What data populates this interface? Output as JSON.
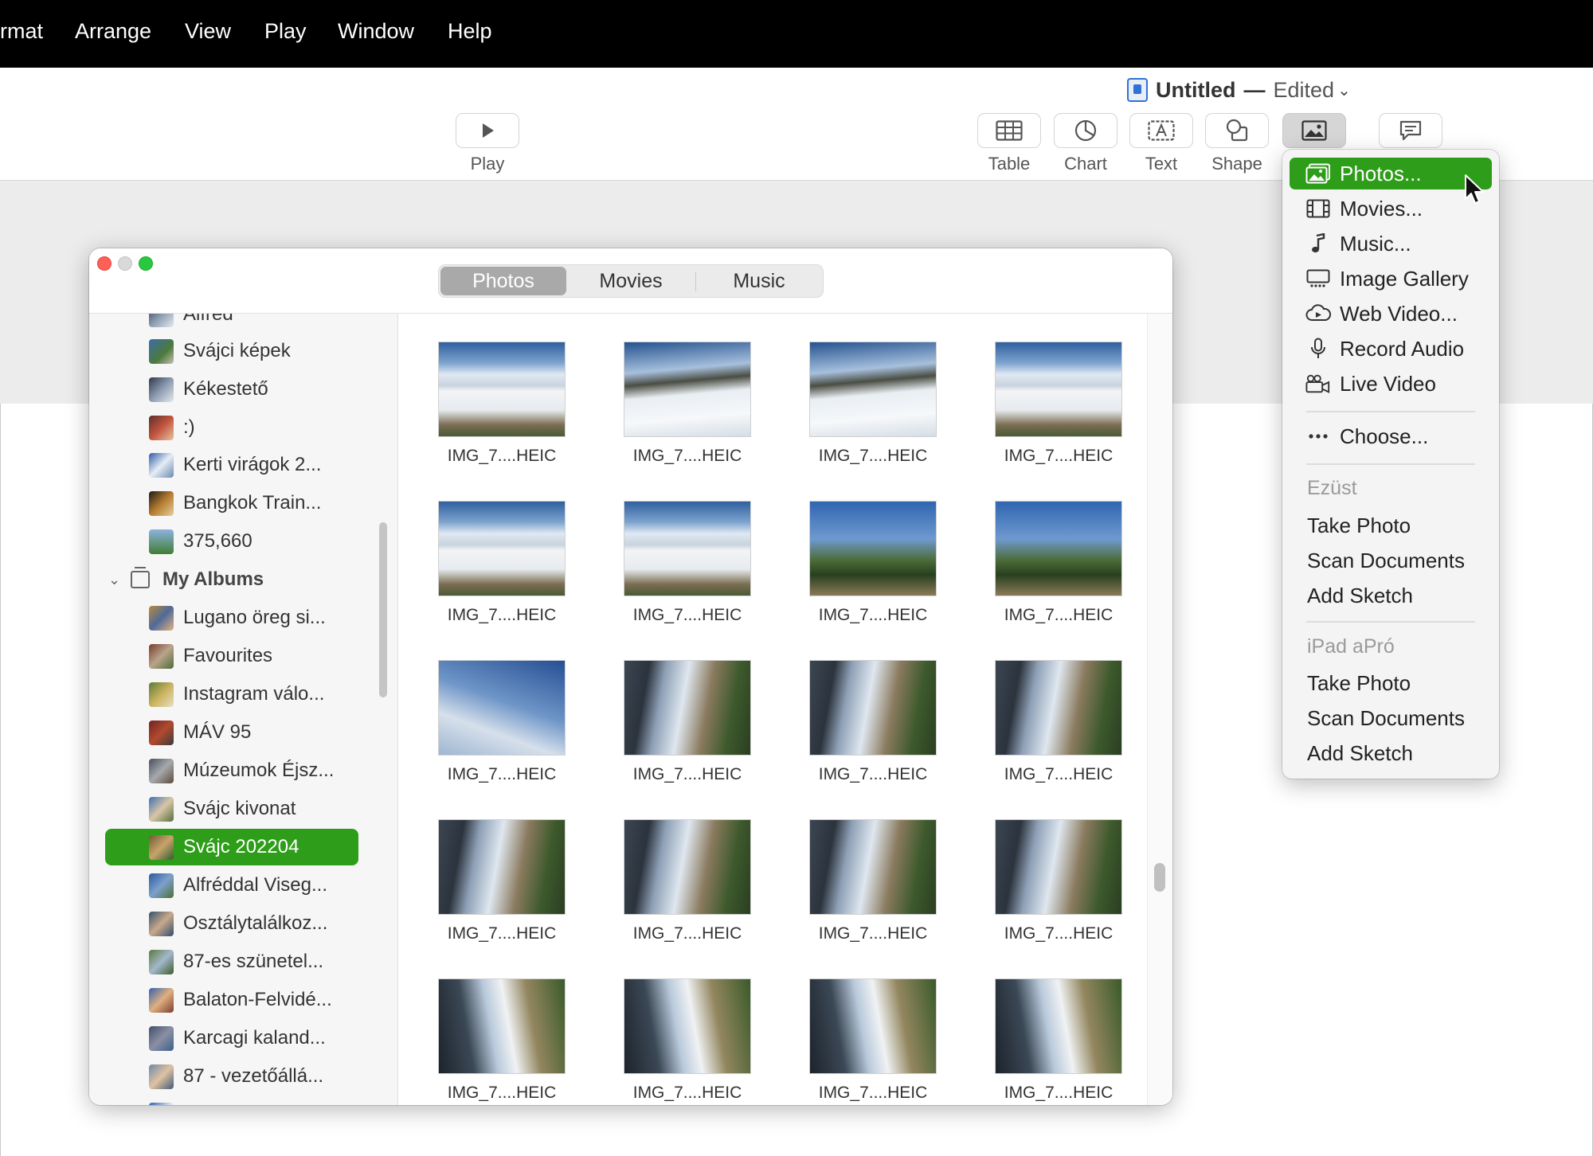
{
  "menubar": {
    "items": [
      {
        "label": "rmat"
      },
      {
        "label": "Arrange"
      },
      {
        "label": "View"
      },
      {
        "label": "Play"
      },
      {
        "label": "Window"
      },
      {
        "label": "Help"
      }
    ]
  },
  "document": {
    "title": "Untitled",
    "separator": "—",
    "status": "Edited"
  },
  "toolbar": {
    "play_label": "Play",
    "table_label": "Table",
    "chart_label": "Chart",
    "text_label": "Text",
    "shape_label": "Shape"
  },
  "media_browser": {
    "tabs": [
      {
        "label": "Photos",
        "active": true
      },
      {
        "label": "Movies",
        "active": false
      },
      {
        "label": "Music",
        "active": false
      }
    ],
    "sidebar": {
      "partial_top_label": "Alfred",
      "items_before_group": [
        {
          "label": "Svájci képek",
          "icon": "album-thumbnail"
        },
        {
          "label": "Kékestető",
          "icon": "album-thumbnail"
        },
        {
          "label": ":)",
          "icon": "album-thumbnail"
        },
        {
          "label": "Kerti virágok 2...",
          "icon": "album-thumbnail"
        },
        {
          "label": "Bangkok Train...",
          "icon": "album-thumbnail"
        },
        {
          "label": "375,660",
          "icon": "album-thumbnail"
        }
      ],
      "group_label": "My Albums",
      "albums": [
        {
          "label": "Lugano öreg si...",
          "selected": false
        },
        {
          "label": "Favourites",
          "selected": false
        },
        {
          "label": "Instagram válo...",
          "selected": false
        },
        {
          "label": "MÁV 95",
          "selected": false
        },
        {
          "label": "Múzeumok Éjsz...",
          "selected": false
        },
        {
          "label": "Svájc kivonat",
          "selected": false
        },
        {
          "label": "Svájc 202204",
          "selected": true
        },
        {
          "label": "Alfréddal Viseg...",
          "selected": false
        },
        {
          "label": "Osztálytalálkoz...",
          "selected": false
        },
        {
          "label": "87-es szünetel...",
          "selected": false
        },
        {
          "label": "Balaton-Felvidé...",
          "selected": false
        },
        {
          "label": "Karcagi kaland...",
          "selected": false
        },
        {
          "label": "87 - vezetőállá...",
          "selected": false
        }
      ]
    },
    "photos": [
      {
        "caption": "IMG_7....HEIC",
        "style": "snowA"
      },
      {
        "caption": "IMG_7....HEIC",
        "style": "snowB"
      },
      {
        "caption": "IMG_7....HEIC",
        "style": "snowB"
      },
      {
        "caption": "IMG_7....HEIC",
        "style": "snowA"
      },
      {
        "caption": "IMG_7....HEIC",
        "style": "snowA"
      },
      {
        "caption": "IMG_7....HEIC",
        "style": "snowA"
      },
      {
        "caption": "IMG_7....HEIC",
        "style": "lift"
      },
      {
        "caption": "IMG_7....HEIC",
        "style": "lift"
      },
      {
        "caption": "IMG_7....HEIC",
        "style": "sky"
      },
      {
        "caption": "IMG_7....HEIC",
        "style": "train"
      },
      {
        "caption": "IMG_7....HEIC",
        "style": "train"
      },
      {
        "caption": "IMG_7....HEIC",
        "style": "train"
      },
      {
        "caption": "IMG_7....HEIC",
        "style": "train"
      },
      {
        "caption": "IMG_7....HEIC",
        "style": "train"
      },
      {
        "caption": "IMG_7....HEIC",
        "style": "train"
      },
      {
        "caption": "IMG_7....HEIC",
        "style": "train"
      },
      {
        "caption": "IMG_7....HEIC",
        "style": "train2"
      },
      {
        "caption": "IMG_7....HEIC",
        "style": "train2"
      },
      {
        "caption": "IMG_7....HEIC",
        "style": "train2"
      },
      {
        "caption": "IMG_7....HEIC",
        "style": "train2"
      }
    ]
  },
  "insert_menu": {
    "items": [
      {
        "label": "Photos...",
        "icon": "photos-icon",
        "active": true
      },
      {
        "label": "Movies...",
        "icon": "film-icon",
        "active": false
      },
      {
        "label": "Music...",
        "icon": "music-note-icon",
        "active": false
      },
      {
        "label": "Image Gallery",
        "icon": "image-gallery-icon",
        "active": false
      },
      {
        "label": "Web Video...",
        "icon": "web-video-icon",
        "active": false
      },
      {
        "label": "Record Audio",
        "icon": "microphone-icon",
        "active": false
      },
      {
        "label": "Live Video",
        "icon": "video-camera-icon",
        "active": false
      }
    ],
    "choose_label": "Choose...",
    "device1": {
      "name": "Ezüst",
      "icon": "crescent-moon-icon",
      "items": [
        "Take Photo",
        "Scan Documents",
        "Add Sketch"
      ]
    },
    "device2": {
      "name": "iPad aPró",
      "items": [
        "Take Photo",
        "Scan Documents",
        "Add Sketch"
      ]
    }
  },
  "colors": {
    "accent_green": "#2e9d19",
    "menubar_bg": "#000000"
  }
}
